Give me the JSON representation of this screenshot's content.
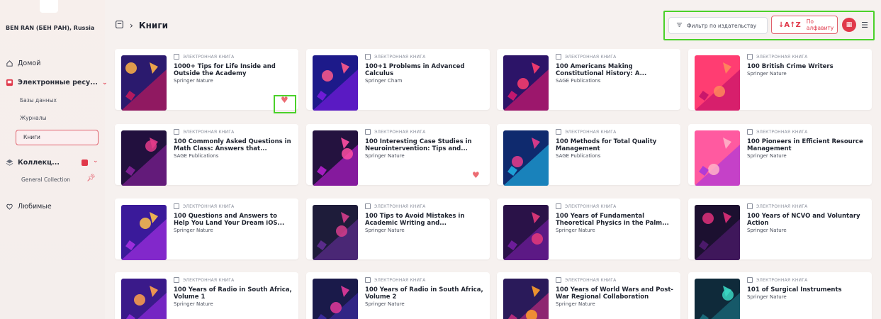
{
  "sidebar": {
    "org_name": "BEN RAN (БЕН РАН), Russia",
    "items": [
      {
        "label": "Домой",
        "icon": "home-icon"
      },
      {
        "label": "Электронные ресу...",
        "icon": "book-red-icon"
      },
      {
        "label": "Коллекц...",
        "icon": "layers-icon"
      },
      {
        "label": "Любимые",
        "icon": "heart-outline-icon"
      }
    ],
    "sub_items": [
      "Базы данных",
      "Журналы",
      "Книги"
    ],
    "collection": "General Collection"
  },
  "header": {
    "breadcrumb": "Книги"
  },
  "toolbar": {
    "filter_label": "Фильтр по издательству",
    "sort_label": "По алфавиту"
  },
  "cards": [
    {
      "type": "ЭЛЕКТРОННАЯ КНИГА",
      "title": "1000+ Tips for Life Inside and Outside the Academy",
      "publisher": "Springer Nature",
      "favorite": true,
      "palette": [
        "#2b1a6e",
        "#b3195e",
        "#ffb347"
      ]
    },
    {
      "type": "ЭЛЕКТРОННАЯ КНИГА",
      "title": "100+1 Problems in Advanced Calculus",
      "publisher": "Springer Cham",
      "favorite": false,
      "palette": [
        "#1d1a8a",
        "#6f1bd6",
        "#ff5a8a"
      ]
    },
    {
      "type": "ЭЛЕКТРОННАЯ КНИГА",
      "title": "100 Americans Making Constitutional History: A...",
      "publisher": "SAGE Publications",
      "favorite": false,
      "palette": [
        "#2c1468",
        "#c2186e",
        "#ff3d6e"
      ]
    },
    {
      "type": "ЭЛЕКТРОННАЯ КНИГА",
      "title": "100 British Crime Writers",
      "publisher": "Springer Nature",
      "favorite": false,
      "palette": [
        "#ff3d72",
        "#c9166b",
        "#ff8a5b"
      ]
    },
    {
      "type": "ЭЛЕКТРОННАЯ КНИГА",
      "title": "100 Commonly Asked Questions in Math Class: Answers that...",
      "publisher": "SAGE Publications",
      "favorite": false,
      "palette": [
        "#22103e",
        "#7a1f8f",
        "#e23b8a"
      ]
    },
    {
      "type": "ЭЛЕКТРОННАЯ КНИГА",
      "title": "100 Interesting Case Studies in Neurointervention: Tips and...",
      "publisher": "Springer Nature",
      "favorite": true,
      "palette": [
        "#24123f",
        "#a51dbe",
        "#ff4fa3"
      ]
    },
    {
      "type": "ЭЛЕКТРОННАЯ КНИГА",
      "title": "100 Methods for Total Quality Management",
      "publisher": "SAGE Publications",
      "favorite": false,
      "palette": [
        "#0f2a6e",
        "#1ea0d6",
        "#e83c8c"
      ]
    },
    {
      "type": "ЭЛЕКТРОННАЯ КНИГА",
      "title": "100 Pioneers in Efficient Resource Management",
      "publisher": "Springer Nature",
      "favorite": false,
      "palette": [
        "#ff5aa0",
        "#b23ad6",
        "#ffb3c8"
      ]
    },
    {
      "type": "ЭЛЕКТРОННАЯ КНИГА",
      "title": "100 Questions and Answers to Help You Land Your Dream iOS...",
      "publisher": "Springer Nature",
      "favorite": false,
      "palette": [
        "#3a1a9a",
        "#9b2ddb",
        "#ffc24a"
      ]
    },
    {
      "type": "ЭЛЕКТРОННАЯ КНИГА",
      "title": "100 Tips to Avoid Mistakes in Academic Writing and...",
      "publisher": "Springer Nature",
      "favorite": false,
      "palette": [
        "#1e1c3a",
        "#5a2b8a",
        "#d63d8c"
      ]
    },
    {
      "type": "ЭЛЕКТРОННАЯ КНИГА",
      "title": "100 Years of Fundamental Theoretical Physics in the Palm...",
      "publisher": "Springer Nature",
      "favorite": false,
      "palette": [
        "#2a1248",
        "#6d1c9a",
        "#e53a7a"
      ]
    },
    {
      "type": "ЭЛЕКТРОННАЯ КНИГА",
      "title": "100 Years of NCVO and Voluntary Action",
      "publisher": "Springer Nature",
      "favorite": false,
      "palette": [
        "#1c1030",
        "#4b1a6a",
        "#e0307a"
      ]
    },
    {
      "type": "ЭЛЕКТРОННАЯ КНИГА",
      "title": "100 Years of Radio in South Africa, Volume 1",
      "publisher": "Springer Nature",
      "favorite": false,
      "palette": [
        "#3a1a8a",
        "#8a2ad6",
        "#ffa24a"
      ]
    },
    {
      "type": "ЭЛЕКТРОННАЯ КНИГА",
      "title": "100 Years of Radio in South Africa, Volume 2",
      "publisher": "Springer Nature",
      "favorite": false,
      "palette": [
        "#1a1a4a",
        "#3a2a9a",
        "#e23a9a"
      ]
    },
    {
      "type": "ЭЛЕКТРОННАЯ КНИГА",
      "title": "100 Years of World Wars and Post-War Regional Collaboration",
      "publisher": "Springer Nature",
      "favorite": false,
      "palette": [
        "#2a1a5a",
        "#b02a7a",
        "#ffa02a"
      ]
    },
    {
      "type": "ЭЛЕКТРОННАЯ КНИГА",
      "title": "101 of Surgical Instruments",
      "publisher": "Springer Nature",
      "favorite": false,
      "palette": [
        "#0f2a3a",
        "#1a6a7a",
        "#3ad6c2"
      ]
    }
  ]
}
